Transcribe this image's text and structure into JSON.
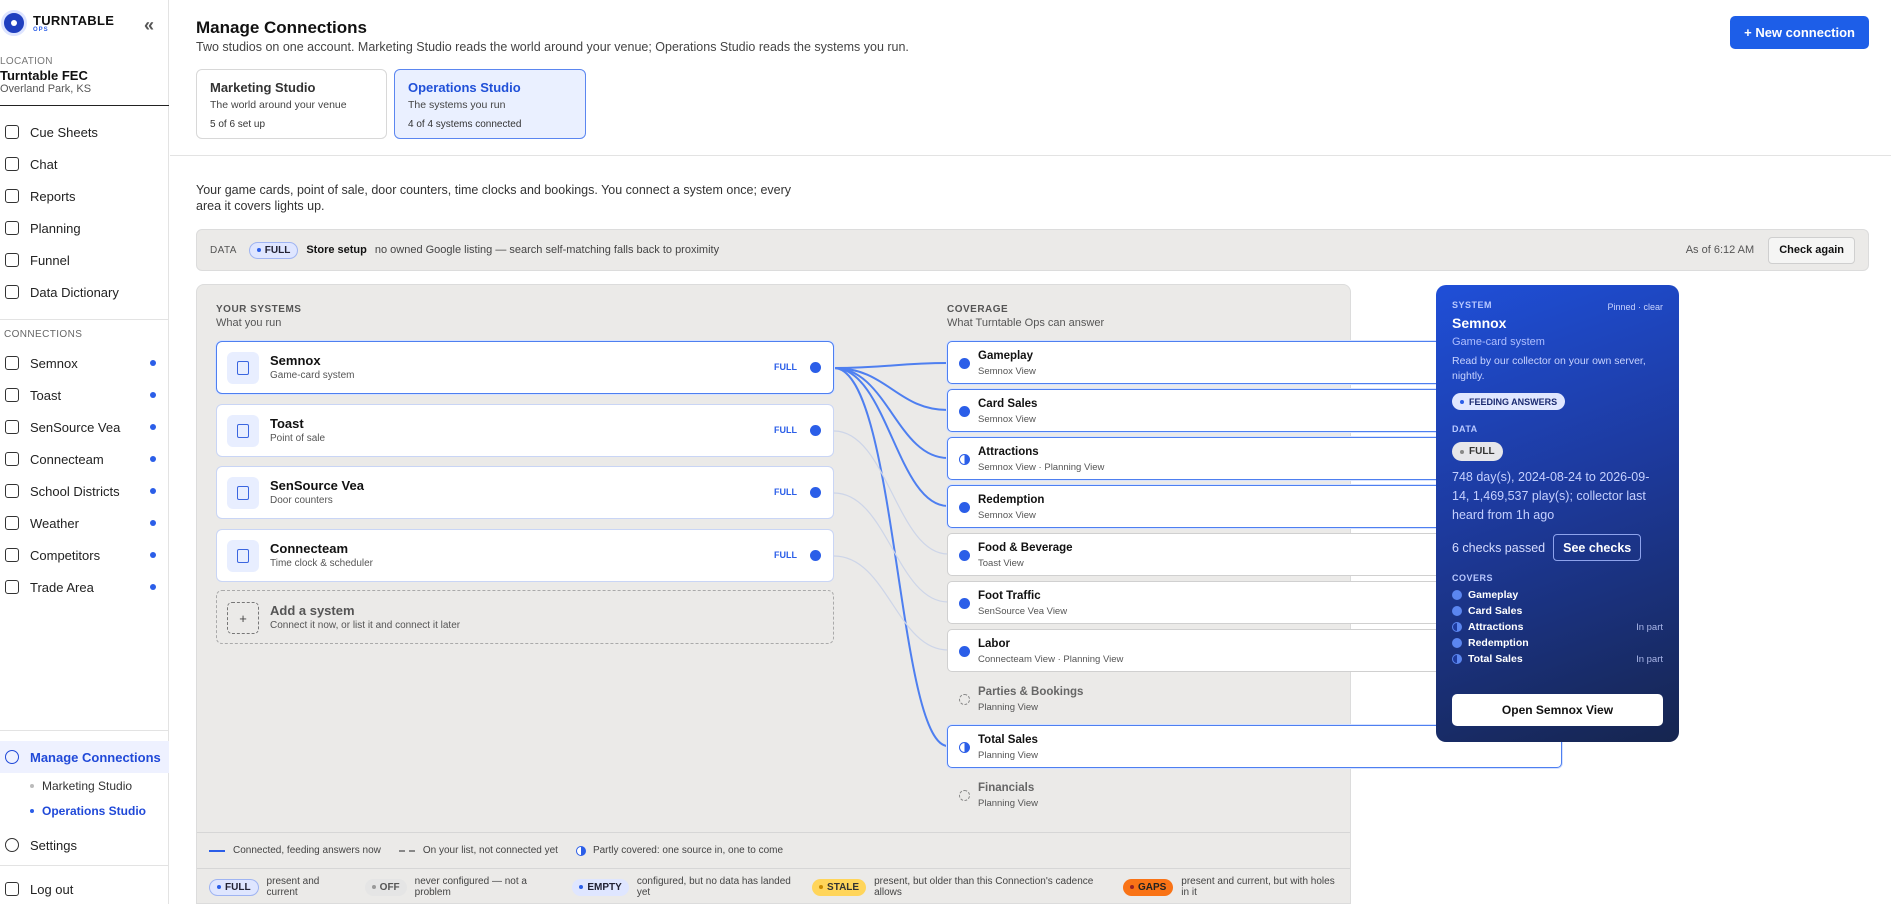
{
  "app": {
    "brand": "TURNTABLE",
    "brand_sub": "OPS",
    "collapse_glyph": "«"
  },
  "location": {
    "label": "LOCATION",
    "name": "Turntable FEC",
    "city": "Overland Park, KS"
  },
  "nav": [
    {
      "label": "Cue Sheets",
      "icon": "clipboard-icon"
    },
    {
      "label": "Chat",
      "icon": "chat-icon"
    },
    {
      "label": "Reports",
      "icon": "report-icon"
    },
    {
      "label": "Planning",
      "icon": "calendar-icon"
    },
    {
      "label": "Funnel",
      "icon": "funnel-icon"
    },
    {
      "label": "Data Dictionary",
      "icon": "book-icon"
    }
  ],
  "connections_label": "CONNECTIONS",
  "connections": [
    {
      "label": "Semnox",
      "icon": "card-icon"
    },
    {
      "label": "Toast",
      "icon": "cup-icon"
    },
    {
      "label": "SenSource Vea",
      "icon": "footprints-icon"
    },
    {
      "label": "Connecteam",
      "icon": "person-icon"
    },
    {
      "label": "School Districts",
      "icon": "school-icon"
    },
    {
      "label": "Weather",
      "icon": "cloud-icon"
    },
    {
      "label": "Competitors",
      "icon": "compass-icon"
    },
    {
      "label": "Trade Area",
      "icon": "target-icon"
    }
  ],
  "bottom_nav": {
    "manage": "Manage Connections",
    "sub": [
      "Marketing Studio",
      "Operations Studio"
    ],
    "settings": "Settings",
    "logout": "Log out"
  },
  "header": {
    "title": "Manage Connections",
    "subtitle": "Two studios on one account. Marketing Studio reads the world around your venue; Operations Studio reads the systems you run.",
    "new_button": "+ New connection"
  },
  "studios": [
    {
      "title": "Marketing Studio",
      "sub": "The world around your venue",
      "count": "5 of 6 set up"
    },
    {
      "title": "Operations Studio",
      "sub": "The systems you run",
      "count": "4 of 4 systems connected"
    }
  ],
  "intro": "Your game cards, point of sale, door counters, time clocks and bookings. You connect a system once; every area it covers lights up.",
  "databar": {
    "label": "DATA",
    "pill": "FULL",
    "setup": "Store setup",
    "note": "no owned Google listing — search self-matching falls back to proximity",
    "asof": "As of 6:12 AM",
    "check": "Check again"
  },
  "systems_head": {
    "title": "YOUR SYSTEMS",
    "sub": "What you run"
  },
  "systems": [
    {
      "name": "Semnox",
      "desc": "Game-card system",
      "status": "FULL"
    },
    {
      "name": "Toast",
      "desc": "Point of sale",
      "status": "FULL"
    },
    {
      "name": "SenSource Vea",
      "desc": "Door counters",
      "status": "FULL"
    },
    {
      "name": "Connecteam",
      "desc": "Time clock & scheduler",
      "status": "FULL"
    }
  ],
  "add_system": {
    "plus": "+",
    "title": "Add a system",
    "sub": "Connect it now, or list it and connect it later"
  },
  "coverage_head": {
    "title": "COVERAGE",
    "sub": "What Turntable Ops can answer"
  },
  "coverage": [
    {
      "name": "Gameplay",
      "via": "Semnox View"
    },
    {
      "name": "Card Sales",
      "via": "Semnox View"
    },
    {
      "name": "Attractions",
      "via": "Semnox View · Planning View"
    },
    {
      "name": "Redemption",
      "via": "Semnox View"
    },
    {
      "name": "Food & Beverage",
      "via": "Toast View"
    },
    {
      "name": "Foot Traffic",
      "via": "SenSource Vea View"
    },
    {
      "name": "Labor",
      "via": "Connecteam View · Planning View"
    },
    {
      "name": "Parties & Bookings",
      "via": "Planning View"
    },
    {
      "name": "Total Sales",
      "via": "Planning View"
    },
    {
      "name": "Financials",
      "via": "Planning View"
    }
  ],
  "legend": {
    "connected": "Connected, feeding answers now",
    "listed": "On your list, not connected yet",
    "partial": "Partly covered: one source in, one to come"
  },
  "status_legend": [
    {
      "pill": "FULL",
      "text": "present and current"
    },
    {
      "pill": "OFF",
      "text": "never configured — not a problem"
    },
    {
      "pill": "EMPTY",
      "text": "configured, but no data has landed yet"
    },
    {
      "pill": "STALE",
      "text": "present, but older than this Connection's cadence allows"
    },
    {
      "pill": "GAPS",
      "text": "present and current, but with holes in it"
    }
  ],
  "card": {
    "label": "SYSTEM",
    "pinned": "Pinned · clear",
    "name": "Semnox",
    "type": "Game-card system",
    "read": "Read by our collector on your own server, nightly.",
    "feeding": "FEEDING ANSWERS",
    "data_label": "DATA",
    "data_pill": "FULL",
    "info": "748 day(s), 2024-08-24 to 2026-09-14, 1,469,537 play(s); collector last heard from 1h ago",
    "checks": "6 checks passed",
    "see_checks": "See checks",
    "covers_label": "COVERS",
    "covers": [
      {
        "name": "Gameplay",
        "part": ""
      },
      {
        "name": "Card Sales",
        "part": ""
      },
      {
        "name": "Attractions",
        "part": "In part"
      },
      {
        "name": "Redemption",
        "part": ""
      },
      {
        "name": "Total Sales",
        "part": "In part"
      }
    ],
    "open": "Open Semnox View"
  },
  "colors": {
    "accent": "#2b5ee8",
    "button": "#1d5ee8",
    "card_top": "#1f4fd8",
    "card_bottom": "#16254f"
  }
}
